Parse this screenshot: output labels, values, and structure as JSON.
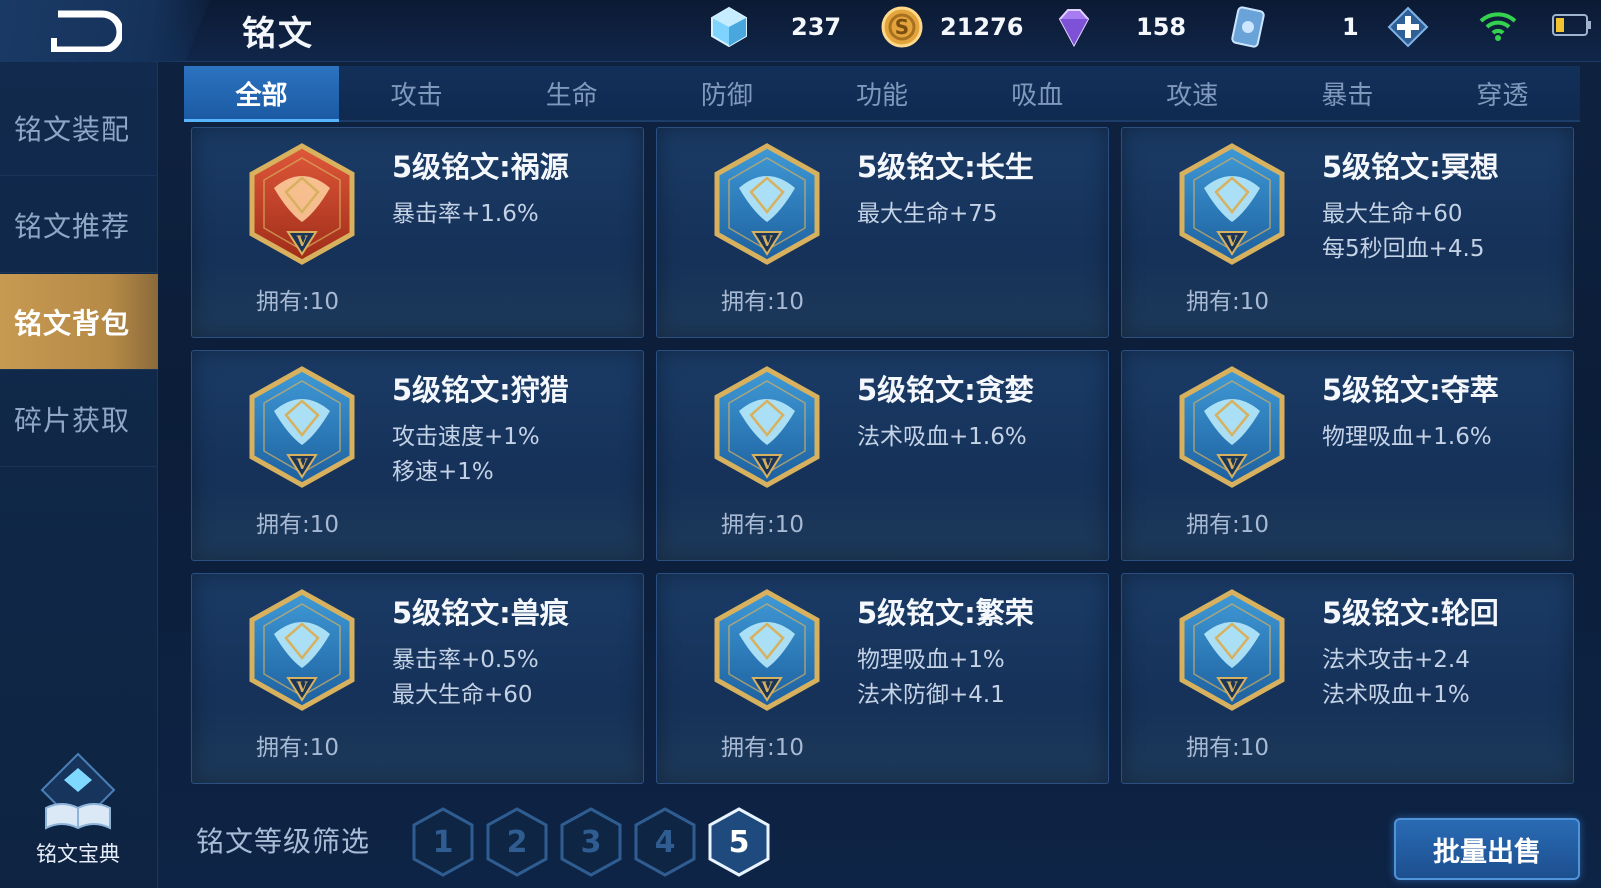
{
  "header": {
    "title": "铭文",
    "currencies": [
      {
        "icon": "diamond-crystal-icon",
        "value": "237"
      },
      {
        "icon": "gold-coin-icon",
        "value": "21276"
      },
      {
        "icon": "purple-gem-icon",
        "value": "158"
      },
      {
        "icon": "voucher-card-icon",
        "value": "1"
      }
    ]
  },
  "sidebar": {
    "items": [
      {
        "label": "铭文装配"
      },
      {
        "label": "铭文推荐"
      },
      {
        "label": "铭文背包",
        "active": true
      },
      {
        "label": "碎片获取"
      }
    ],
    "codex_label": "铭文宝典"
  },
  "tabs": [
    "全部",
    "攻击",
    "生命",
    "防御",
    "功能",
    "吸血",
    "攻速",
    "暴击",
    "穿透"
  ],
  "active_tab": "全部",
  "runes": [
    {
      "name": "5级铭文:祸源",
      "stats": [
        "暴击率+1.6%",
        ""
      ],
      "owned": "拥有:10",
      "color": "red",
      "icon": "rune-huoyuan-icon"
    },
    {
      "name": "5级铭文:长生",
      "stats": [
        "最大生命+75",
        ""
      ],
      "owned": "拥有:10",
      "color": "blue",
      "icon": "rune-changsheng-icon"
    },
    {
      "name": "5级铭文:冥想",
      "stats": [
        "最大生命+60",
        "每5秒回血+4.5"
      ],
      "owned": "拥有:10",
      "color": "blue",
      "icon": "rune-mingxiang-icon"
    },
    {
      "name": "5级铭文:狩猎",
      "stats": [
        "攻击速度+1%",
        "移速+1%"
      ],
      "owned": "拥有:10",
      "color": "blue",
      "icon": "rune-shoulie-icon"
    },
    {
      "name": "5级铭文:贪婪",
      "stats": [
        "法术吸血+1.6%",
        ""
      ],
      "owned": "拥有:10",
      "color": "blue",
      "icon": "rune-tanlan-icon"
    },
    {
      "name": "5级铭文:夺萃",
      "stats": [
        "物理吸血+1.6%",
        ""
      ],
      "owned": "拥有:10",
      "color": "blue",
      "icon": "rune-duocui-icon"
    },
    {
      "name": "5级铭文:兽痕",
      "stats": [
        "暴击率+0.5%",
        "最大生命+60"
      ],
      "owned": "拥有:10",
      "color": "blue",
      "icon": "rune-shouhen-icon"
    },
    {
      "name": "5级铭文:繁荣",
      "stats": [
        "物理吸血+1%",
        "法术防御+4.1"
      ],
      "owned": "拥有:10",
      "color": "blue",
      "icon": "rune-fanrong-icon"
    },
    {
      "name": "5级铭文:轮回",
      "stats": [
        "法术攻击+2.4",
        "法术吸血+1%"
      ],
      "owned": "拥有:10",
      "color": "blue",
      "icon": "rune-lunhui-icon"
    }
  ],
  "filter": {
    "label": "铭文等级筛选",
    "levels": [
      "1",
      "2",
      "3",
      "4",
      "5"
    ],
    "active_level": "5"
  },
  "actions": {
    "bulk_sell_label": "批量出售"
  },
  "colors": {
    "accent_gold": "#c79a52",
    "tab_active": "#1b5aa3",
    "red_rune": "#c0432a",
    "blue_rune": "#2b7fc4",
    "rune_frame": "#d8b15e"
  }
}
